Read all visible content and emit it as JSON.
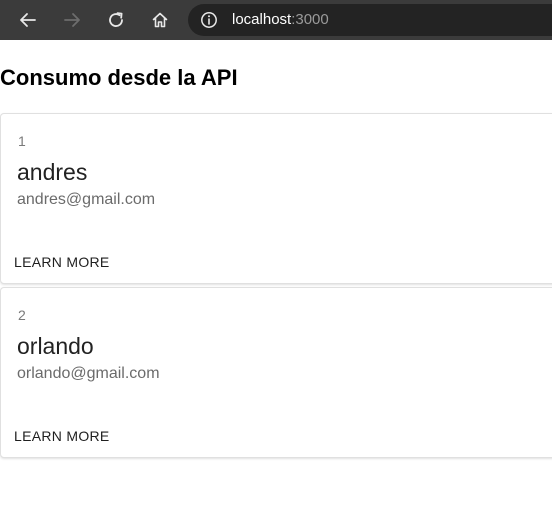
{
  "browser": {
    "url_host": "localhost",
    "url_port": ":3000",
    "icons": [
      "back-arrow-icon",
      "forward-arrow-icon",
      "reload-icon",
      "home-icon",
      "info-icon"
    ]
  },
  "page": {
    "title": "Consumo desde la API"
  },
  "cards": [
    {
      "id": "1",
      "name": "andres",
      "email": "andres@gmail.com",
      "action_label": "LEARN MORE"
    },
    {
      "id": "2",
      "name": "orlando",
      "email": "orlando@gmail.com",
      "action_label": "LEARN MORE"
    }
  ],
  "colors": {
    "toolbar_bg": "#3b3b3b",
    "address_bar_bg": "#232323",
    "card_border": "#e0e0e0"
  }
}
